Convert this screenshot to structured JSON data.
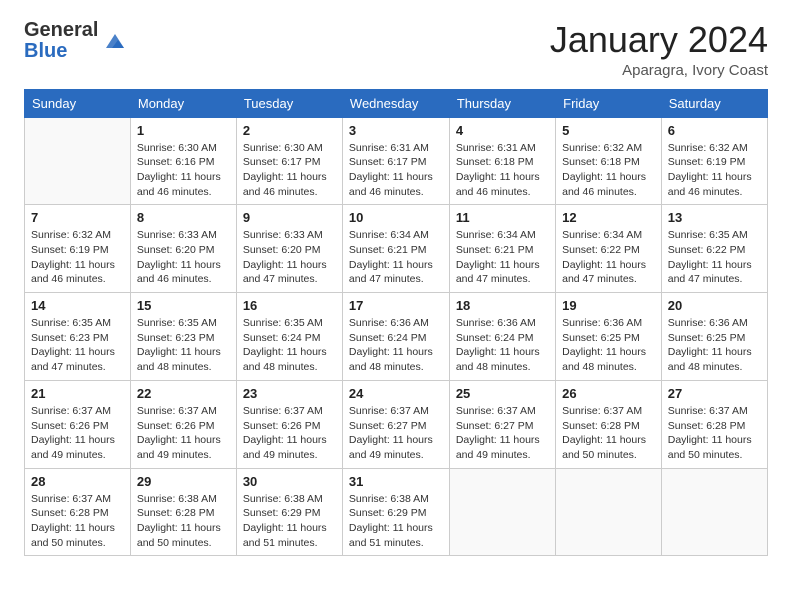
{
  "header": {
    "logo_general": "General",
    "logo_blue": "Blue",
    "title": "January 2024",
    "location": "Aparagra, Ivory Coast"
  },
  "weekdays": [
    "Sunday",
    "Monday",
    "Tuesday",
    "Wednesday",
    "Thursday",
    "Friday",
    "Saturday"
  ],
  "weeks": [
    [
      {
        "day": "",
        "info": ""
      },
      {
        "day": "1",
        "info": "Sunrise: 6:30 AM\nSunset: 6:16 PM\nDaylight: 11 hours and 46 minutes."
      },
      {
        "day": "2",
        "info": "Sunrise: 6:30 AM\nSunset: 6:17 PM\nDaylight: 11 hours and 46 minutes."
      },
      {
        "day": "3",
        "info": "Sunrise: 6:31 AM\nSunset: 6:17 PM\nDaylight: 11 hours and 46 minutes."
      },
      {
        "day": "4",
        "info": "Sunrise: 6:31 AM\nSunset: 6:18 PM\nDaylight: 11 hours and 46 minutes."
      },
      {
        "day": "5",
        "info": "Sunrise: 6:32 AM\nSunset: 6:18 PM\nDaylight: 11 hours and 46 minutes."
      },
      {
        "day": "6",
        "info": "Sunrise: 6:32 AM\nSunset: 6:19 PM\nDaylight: 11 hours and 46 minutes."
      }
    ],
    [
      {
        "day": "7",
        "info": "Sunrise: 6:32 AM\nSunset: 6:19 PM\nDaylight: 11 hours and 46 minutes."
      },
      {
        "day": "8",
        "info": "Sunrise: 6:33 AM\nSunset: 6:20 PM\nDaylight: 11 hours and 46 minutes."
      },
      {
        "day": "9",
        "info": "Sunrise: 6:33 AM\nSunset: 6:20 PM\nDaylight: 11 hours and 47 minutes."
      },
      {
        "day": "10",
        "info": "Sunrise: 6:34 AM\nSunset: 6:21 PM\nDaylight: 11 hours and 47 minutes."
      },
      {
        "day": "11",
        "info": "Sunrise: 6:34 AM\nSunset: 6:21 PM\nDaylight: 11 hours and 47 minutes."
      },
      {
        "day": "12",
        "info": "Sunrise: 6:34 AM\nSunset: 6:22 PM\nDaylight: 11 hours and 47 minutes."
      },
      {
        "day": "13",
        "info": "Sunrise: 6:35 AM\nSunset: 6:22 PM\nDaylight: 11 hours and 47 minutes."
      }
    ],
    [
      {
        "day": "14",
        "info": "Sunrise: 6:35 AM\nSunset: 6:23 PM\nDaylight: 11 hours and 47 minutes."
      },
      {
        "day": "15",
        "info": "Sunrise: 6:35 AM\nSunset: 6:23 PM\nDaylight: 11 hours and 48 minutes."
      },
      {
        "day": "16",
        "info": "Sunrise: 6:35 AM\nSunset: 6:24 PM\nDaylight: 11 hours and 48 minutes."
      },
      {
        "day": "17",
        "info": "Sunrise: 6:36 AM\nSunset: 6:24 PM\nDaylight: 11 hours and 48 minutes."
      },
      {
        "day": "18",
        "info": "Sunrise: 6:36 AM\nSunset: 6:24 PM\nDaylight: 11 hours and 48 minutes."
      },
      {
        "day": "19",
        "info": "Sunrise: 6:36 AM\nSunset: 6:25 PM\nDaylight: 11 hours and 48 minutes."
      },
      {
        "day": "20",
        "info": "Sunrise: 6:36 AM\nSunset: 6:25 PM\nDaylight: 11 hours and 48 minutes."
      }
    ],
    [
      {
        "day": "21",
        "info": "Sunrise: 6:37 AM\nSunset: 6:26 PM\nDaylight: 11 hours and 49 minutes."
      },
      {
        "day": "22",
        "info": "Sunrise: 6:37 AM\nSunset: 6:26 PM\nDaylight: 11 hours and 49 minutes."
      },
      {
        "day": "23",
        "info": "Sunrise: 6:37 AM\nSunset: 6:26 PM\nDaylight: 11 hours and 49 minutes."
      },
      {
        "day": "24",
        "info": "Sunrise: 6:37 AM\nSunset: 6:27 PM\nDaylight: 11 hours and 49 minutes."
      },
      {
        "day": "25",
        "info": "Sunrise: 6:37 AM\nSunset: 6:27 PM\nDaylight: 11 hours and 49 minutes."
      },
      {
        "day": "26",
        "info": "Sunrise: 6:37 AM\nSunset: 6:28 PM\nDaylight: 11 hours and 50 minutes."
      },
      {
        "day": "27",
        "info": "Sunrise: 6:37 AM\nSunset: 6:28 PM\nDaylight: 11 hours and 50 minutes."
      }
    ],
    [
      {
        "day": "28",
        "info": "Sunrise: 6:37 AM\nSunset: 6:28 PM\nDaylight: 11 hours and 50 minutes."
      },
      {
        "day": "29",
        "info": "Sunrise: 6:38 AM\nSunset: 6:28 PM\nDaylight: 11 hours and 50 minutes."
      },
      {
        "day": "30",
        "info": "Sunrise: 6:38 AM\nSunset: 6:29 PM\nDaylight: 11 hours and 51 minutes."
      },
      {
        "day": "31",
        "info": "Sunrise: 6:38 AM\nSunset: 6:29 PM\nDaylight: 11 hours and 51 minutes."
      },
      {
        "day": "",
        "info": ""
      },
      {
        "day": "",
        "info": ""
      },
      {
        "day": "",
        "info": ""
      }
    ]
  ]
}
